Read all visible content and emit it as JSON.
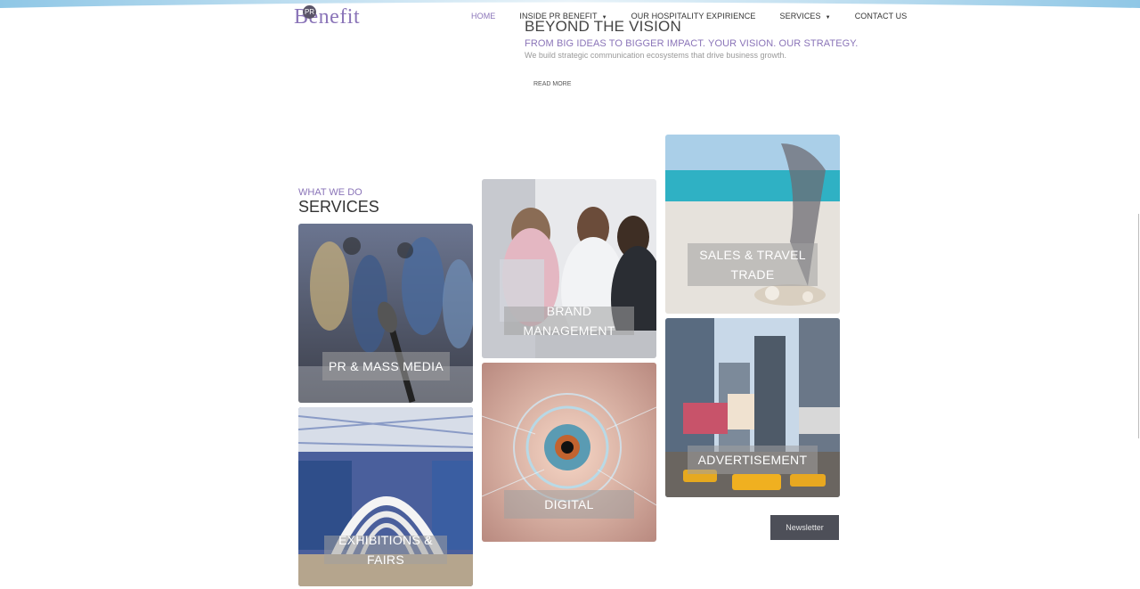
{
  "brand": {
    "badge": "PR",
    "name": "Benefit"
  },
  "nav": {
    "items": [
      {
        "label": "HOME",
        "has_dropdown": false,
        "active": true
      },
      {
        "label": "INSIDE PR BENEFIT",
        "has_dropdown": true,
        "active": false
      },
      {
        "label": "OUR HOSPITALITY EXPIRIENCE",
        "has_dropdown": false,
        "active": false
      },
      {
        "label": "SERVICES",
        "has_dropdown": true,
        "active": false
      },
      {
        "label": "CONTACT US",
        "has_dropdown": false,
        "active": false
      }
    ],
    "dropdown_glyph": "▼"
  },
  "hero": {
    "title": "BEYOND THE VISION",
    "subtitle": "FROM BIG IDEAS TO BIGGER IMPACT. YOUR VISION. OUR STRATEGY.",
    "description": "We build strategic communication ecosystems that drive business growth.",
    "read_more": "READ MORE"
  },
  "services_section": {
    "eyebrow": "WHAT WE DO",
    "title": "SERVICES",
    "tiles": [
      {
        "label": "PR & MASS MEDIA",
        "image": "press-microphone-photo"
      },
      {
        "label": "EXHIBITIONS & FAIRS",
        "image": "exhibition-booth-photo"
      },
      {
        "label": "BRAND MANAGEMENT",
        "image": "office-team-photo"
      },
      {
        "label": "DIGITAL",
        "image": "digital-eye-photo"
      },
      {
        "label": "SALES & TRAVEL TRADE",
        "image": "beach-coral-photo"
      },
      {
        "label": "ADVERTISEMENT",
        "image": "times-square-photo"
      }
    ]
  },
  "newsletter": {
    "label": "Newsletter"
  },
  "colors": {
    "accent": "#8a74b8",
    "text": "#333333",
    "newsletter_bg": "#4d4f58"
  }
}
